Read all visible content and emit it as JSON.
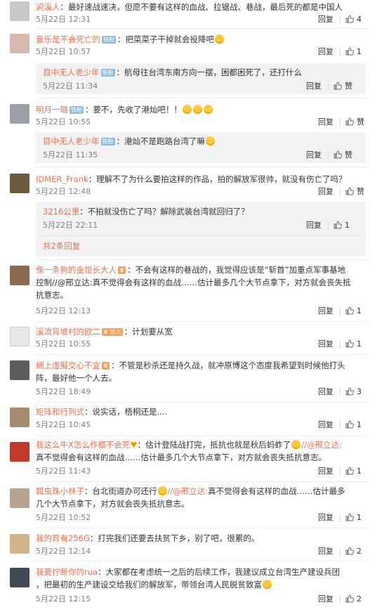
{
  "comments": [
    {
      "user": "涧溪人",
      "badge": "",
      "text": "：最好速战速决，但愿不要有这样的血战、拉锯战、巷战，最后死的都是中国人",
      "time": "5月22日 12:31",
      "reply": "回复",
      "likes": "4"
    },
    {
      "user": "音乐是不会死亡的",
      "badge": "铁粉",
      "text": "：把菜菜子干掉就会投降吧",
      "time": "5月22日 10:57",
      "reply": "回复",
      "likes": "1",
      "subs": [
        {
          "user": "目中无人老少年",
          "badge": "铁粉",
          "text": "：航母往台湾东南方向一摆，困都困死了，还打什么",
          "time": "5月22日 11:34",
          "reply": "回复",
          "likes": "赞"
        }
      ]
    },
    {
      "user": "明月一璐",
      "badge": "铁粉",
      "text": "：要不，先收了港灿吧！！",
      "time": "5月22日 10:55",
      "reply": "回复",
      "likes": "赞",
      "subs": [
        {
          "user": "目中无人老少年",
          "badge": "铁粉",
          "text": "：港灿不是跑路台湾了嘛",
          "time": "5月22日 11:35",
          "reply": "回复",
          "likes": "赞"
        }
      ]
    },
    {
      "user": "IDMER_Frank",
      "badge": "",
      "text": "：理解不了为什么要拍这样的作品，拍的解放军很帅，就没有伤亡了吗？",
      "time": "5月22日 12:48",
      "reply": "回复",
      "likes": "赞",
      "subs": [
        {
          "user": "3216公里",
          "badge": "",
          "text": "：不拍就没伤亡了吗？解除武装台湾就回归了？",
          "time": "5月22日 22:11",
          "reply": "回复",
          "likes": "1"
        }
      ],
      "more": "共2条回复"
    },
    {
      "user": "像一条狗的金馆长大人",
      "badge": "",
      "line1": "：不会有这样的巷战的，我觉得应该是“斩首”加重点军事基地",
      "line2": "控制//@邢立达:真不觉得会有这样的血战……估计最多几个大节点拿下，对方就会丧失抵",
      "line3": "抗意志。",
      "time": "5月22日 12:13",
      "reply": "回复",
      "likes": "1"
    },
    {
      "user": "溪流背坡村的欧二",
      "badge": "",
      "text": "：计划要从宽",
      "time": "5月22日 10:55",
      "reply": "回复",
      "likes": "1"
    },
    {
      "user": "網上虛擬交心不宜",
      "badge": "",
      "line1": "：不管是秒杀还是持久战，就冲原博这个态度我希望到时候他打头",
      "line2": "阵，最好他一个人去。",
      "time": "5月22日 18:49",
      "reply": "回复",
      "likes": "3"
    },
    {
      "user": "矩阵和行列式",
      "badge": "",
      "text": "：说实话，梧桐还是....",
      "time": "5月22日 10:45",
      "reply": "回复",
      "likes": "1"
    },
    {
      "user": "我这么牛X怎么作都不会死",
      "badge": "",
      "line1": "：估计登陆战打完，抵抗也就是秋后蚂蚱了",
      "mention": "//@邢立达:",
      "line2": "真不觉得会有这样的血战……估计最多几个大节点拿下，对方就会丧失抵抗意志。",
      "time": "5月22日 11:43",
      "reply": "回复",
      "likes": "1"
    },
    {
      "user": "瓢虫珠小林子",
      "badge": "",
      "line1": "：台北街道办可还行",
      "mention": "//@邢立达:",
      "line1b": "真不觉得会有这样的血战……估计最多",
      "line2": "几个大节点拿下，对方就会丧失抵抗意志。",
      "time": "5月22日 10:52",
      "reply": "回复",
      "likes": "1"
    },
    {
      "user": "我的胃有256G",
      "badge": "",
      "text": "：打完我们还要去扶贫下乡，别了吧，很累的。",
      "time": "5月22日 12:14",
      "reply": "回复",
      "likes": "2"
    },
    {
      "user": "我要拧断你的rua",
      "badge": "",
      "line1": "：大家都在考虑统一之后的后续工作，我建议成立台湾生产建设兵团",
      "line2": "，把最初的生产建设交给我们的解放军，带领台湾人民脱贫致富",
      "time": "5月22日 12:15",
      "reply": "回复",
      "likes": "2"
    }
  ],
  "colors": {
    "accent": "#eb7350",
    "time": "#808080",
    "subbg": "#f2f2f5"
  }
}
